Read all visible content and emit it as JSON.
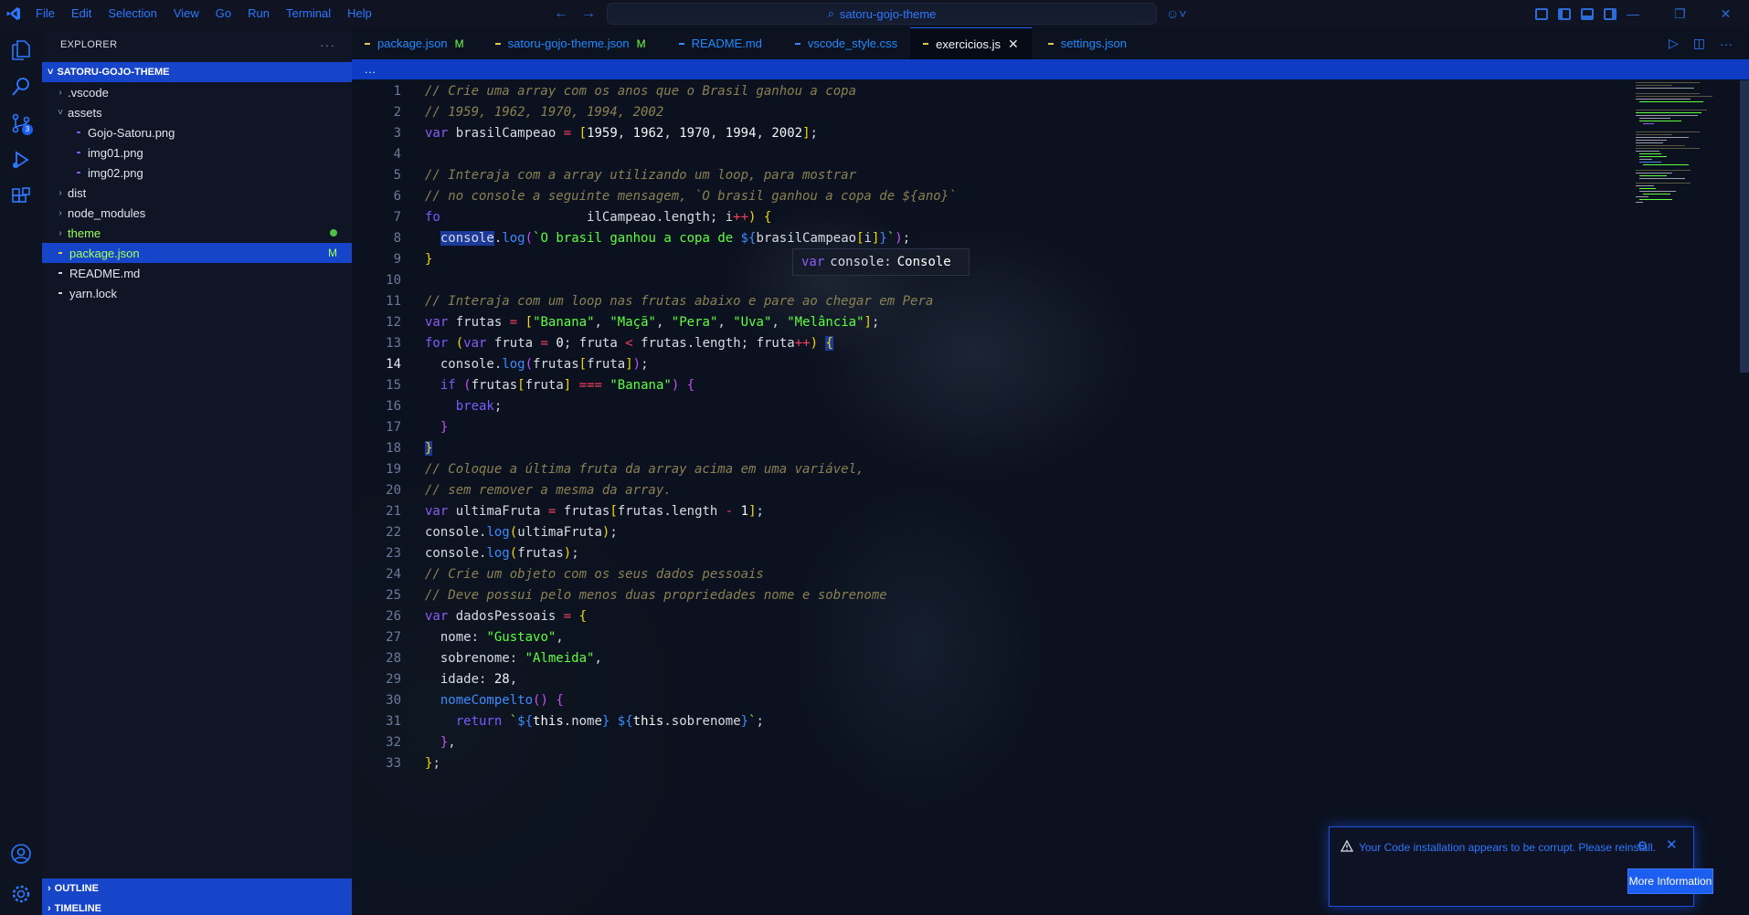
{
  "titlebar": {
    "menu": [
      "File",
      "Edit",
      "Selection",
      "View",
      "Go",
      "Run",
      "Terminal",
      "Help"
    ],
    "search_text": "satoru-gojo-theme"
  },
  "activitybar": {
    "source_control_badge": "3"
  },
  "sidebar": {
    "title": "EXPLORER",
    "more": "···",
    "project": "SATORU-GOJO-THEME",
    "items": [
      {
        "label": ".vscode",
        "type": "folder",
        "expanded": false
      },
      {
        "label": "assets",
        "type": "folder",
        "expanded": true
      },
      {
        "label": "Gojo-Satoru.png",
        "type": "file"
      },
      {
        "label": "img01.png",
        "type": "file"
      },
      {
        "label": "img02.png",
        "type": "file"
      },
      {
        "label": "dist",
        "type": "folder",
        "expanded": false
      },
      {
        "label": "node_modules",
        "type": "folder",
        "expanded": false
      },
      {
        "label": "theme",
        "type": "folder",
        "expanded": false
      },
      {
        "label": "package.json",
        "type": "file",
        "status": "M"
      },
      {
        "label": "README.md",
        "type": "file"
      },
      {
        "label": "yarn.lock",
        "type": "file"
      }
    ],
    "outline": "OUTLINE",
    "timeline": "TIMELINE"
  },
  "tabs": [
    {
      "label": "package.json",
      "mod": "M"
    },
    {
      "label": "satoru-gojo-theme.json",
      "mod": "M"
    },
    {
      "label": "README.md",
      "mod": ""
    },
    {
      "label": "vscode_style.css",
      "mod": ""
    },
    {
      "label": "exercicios.js",
      "mod": "",
      "active": true
    },
    {
      "label": "settings.json",
      "mod": ""
    }
  ],
  "breadcrumb": "...",
  "hover": {
    "kw": "var",
    "name": "console:",
    "type": "Console"
  },
  "code": {
    "current_line": 14,
    "line_numbers": [
      "1",
      "2",
      "3",
      "4",
      "5",
      "6",
      "7",
      "8",
      "9",
      "10",
      "11",
      "12",
      "13",
      "14",
      "15",
      "16",
      "17",
      "18",
      "19",
      "20",
      "21",
      "22",
      "23",
      "24",
      "25",
      "26",
      "27",
      "28",
      "29",
      "30",
      "31",
      "32",
      "33"
    ]
  },
  "notification": {
    "message": "Your Code installation appears to be corrupt. Please reinstall.",
    "button": "More Information"
  },
  "colors": {
    "accent": "#1b5ef0",
    "background": "#0b1120",
    "string": "#5dff40",
    "comment": "#8a8054"
  }
}
